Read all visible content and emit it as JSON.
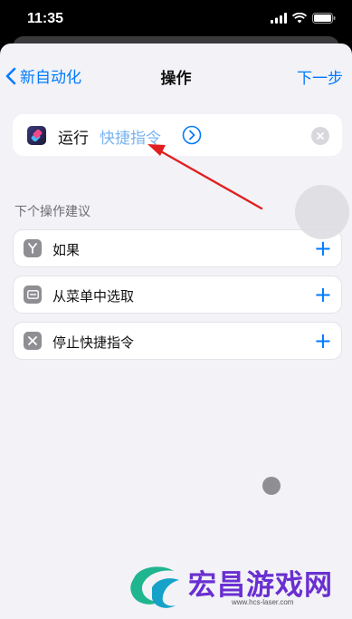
{
  "status_bar": {
    "time": "11:35"
  },
  "nav": {
    "back_label": "新自动化",
    "title": "操作",
    "next_label": "下一步"
  },
  "action": {
    "verb": "运行",
    "parameter": "快捷指令"
  },
  "suggestions": {
    "header": "下个操作建议",
    "items": [
      {
        "label": "如果",
        "icon": "branch-icon"
      },
      {
        "label": "从菜单中选取",
        "icon": "menu-icon"
      },
      {
        "label": "停止快捷指令",
        "icon": "stop-icon"
      }
    ],
    "add_glyph": "+"
  },
  "watermark": {
    "text": "宏昌游戏网",
    "url": "www.hcs-laser.com"
  },
  "colors": {
    "accent": "#007aff",
    "param": "#7ab4ef",
    "annotation": "#e02020",
    "watermark": "#6a2fd0"
  }
}
